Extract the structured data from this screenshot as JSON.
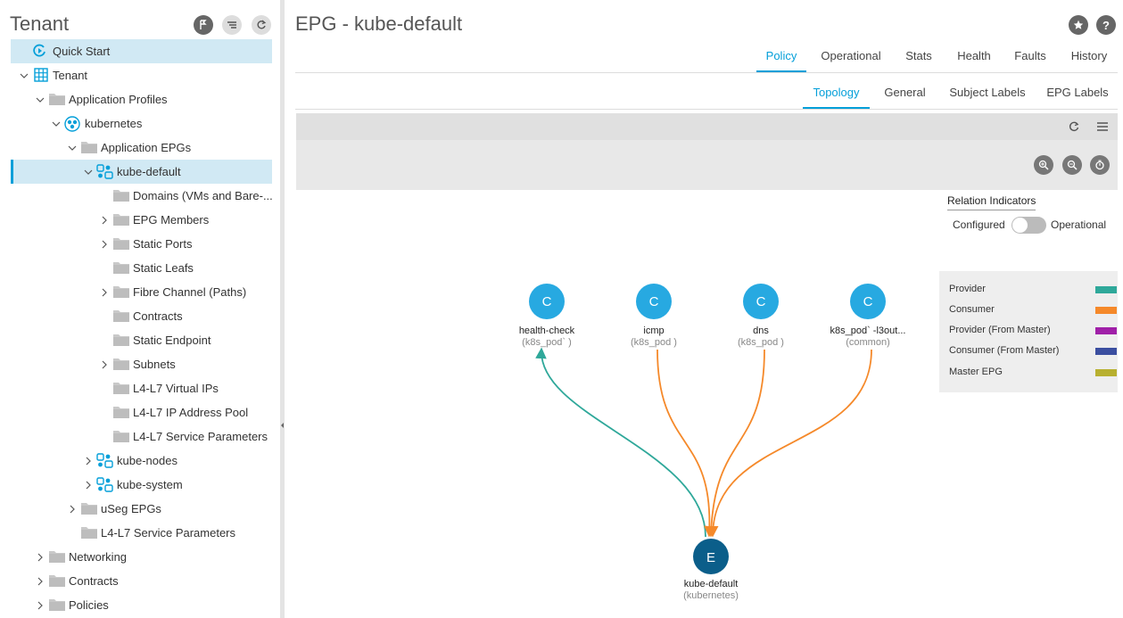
{
  "nav": {
    "title": "Tenant",
    "items": [
      {
        "label": "Quick Start"
      },
      {
        "label": "Tenant"
      },
      {
        "label": "Application Profiles"
      },
      {
        "label": "kubernetes"
      },
      {
        "label": "Application EPGs"
      },
      {
        "label": "kube-default"
      },
      {
        "label": "Domains (VMs and Bare-..."
      },
      {
        "label": "EPG Members"
      },
      {
        "label": "Static Ports"
      },
      {
        "label": "Static Leafs"
      },
      {
        "label": "Fibre Channel (Paths)"
      },
      {
        "label": "Contracts"
      },
      {
        "label": "Static Endpoint"
      },
      {
        "label": "Subnets"
      },
      {
        "label": "L4-L7 Virtual IPs"
      },
      {
        "label": "L4-L7 IP Address Pool"
      },
      {
        "label": "L4-L7 Service Parameters"
      },
      {
        "label": "kube-nodes"
      },
      {
        "label": "kube-system"
      },
      {
        "label": "uSeg EPGs"
      },
      {
        "label": "L4-L7 Service Parameters"
      },
      {
        "label": "Networking"
      },
      {
        "label": "Contracts"
      },
      {
        "label": "Policies"
      }
    ]
  },
  "page": {
    "title": "EPG - kube-default",
    "fav_icon": "star-icon",
    "help_label": "?"
  },
  "tabs": {
    "primary": [
      "Policy",
      "Operational",
      "Stats",
      "Health",
      "Faults",
      "History"
    ],
    "secondary": [
      "Topology",
      "General",
      "Subject Labels",
      "EPG Labels"
    ]
  },
  "relation": {
    "title": "Relation Indicators",
    "left": "Configured",
    "right": "Operational",
    "toggle_on": false
  },
  "legend": [
    {
      "label": "Provider",
      "color": "#2fa89a"
    },
    {
      "label": "Consumer",
      "color": "#f5892a"
    },
    {
      "label": "Provider (From Master)",
      "color": "#a020a8"
    },
    {
      "label": "Consumer (From Master)",
      "color": "#3b4fa0"
    },
    {
      "label": "Master EPG",
      "color": "#b8b030"
    }
  ],
  "topology": {
    "contracts": [
      {
        "letter": "C",
        "name": "health-check",
        "scope": "(k8s_pod`   )",
        "relation": "provider"
      },
      {
        "letter": "C",
        "name": "icmp",
        "scope": "(k8s_pod     )",
        "relation": "consumer"
      },
      {
        "letter": "C",
        "name": "dns",
        "scope": "(k8s_pod     )",
        "relation": "consumer"
      },
      {
        "letter": "C",
        "name": "k8s_pod`     -l3out...",
        "scope": "(common)",
        "relation": "consumer"
      }
    ],
    "epg": {
      "letter": "E",
      "name": "kube-default",
      "scope": "(kubernetes)"
    },
    "colors": {
      "node": "#27a9e1",
      "epg": "#0b5e8a",
      "provider": "#2fa89a",
      "consumer": "#f5892a"
    }
  }
}
